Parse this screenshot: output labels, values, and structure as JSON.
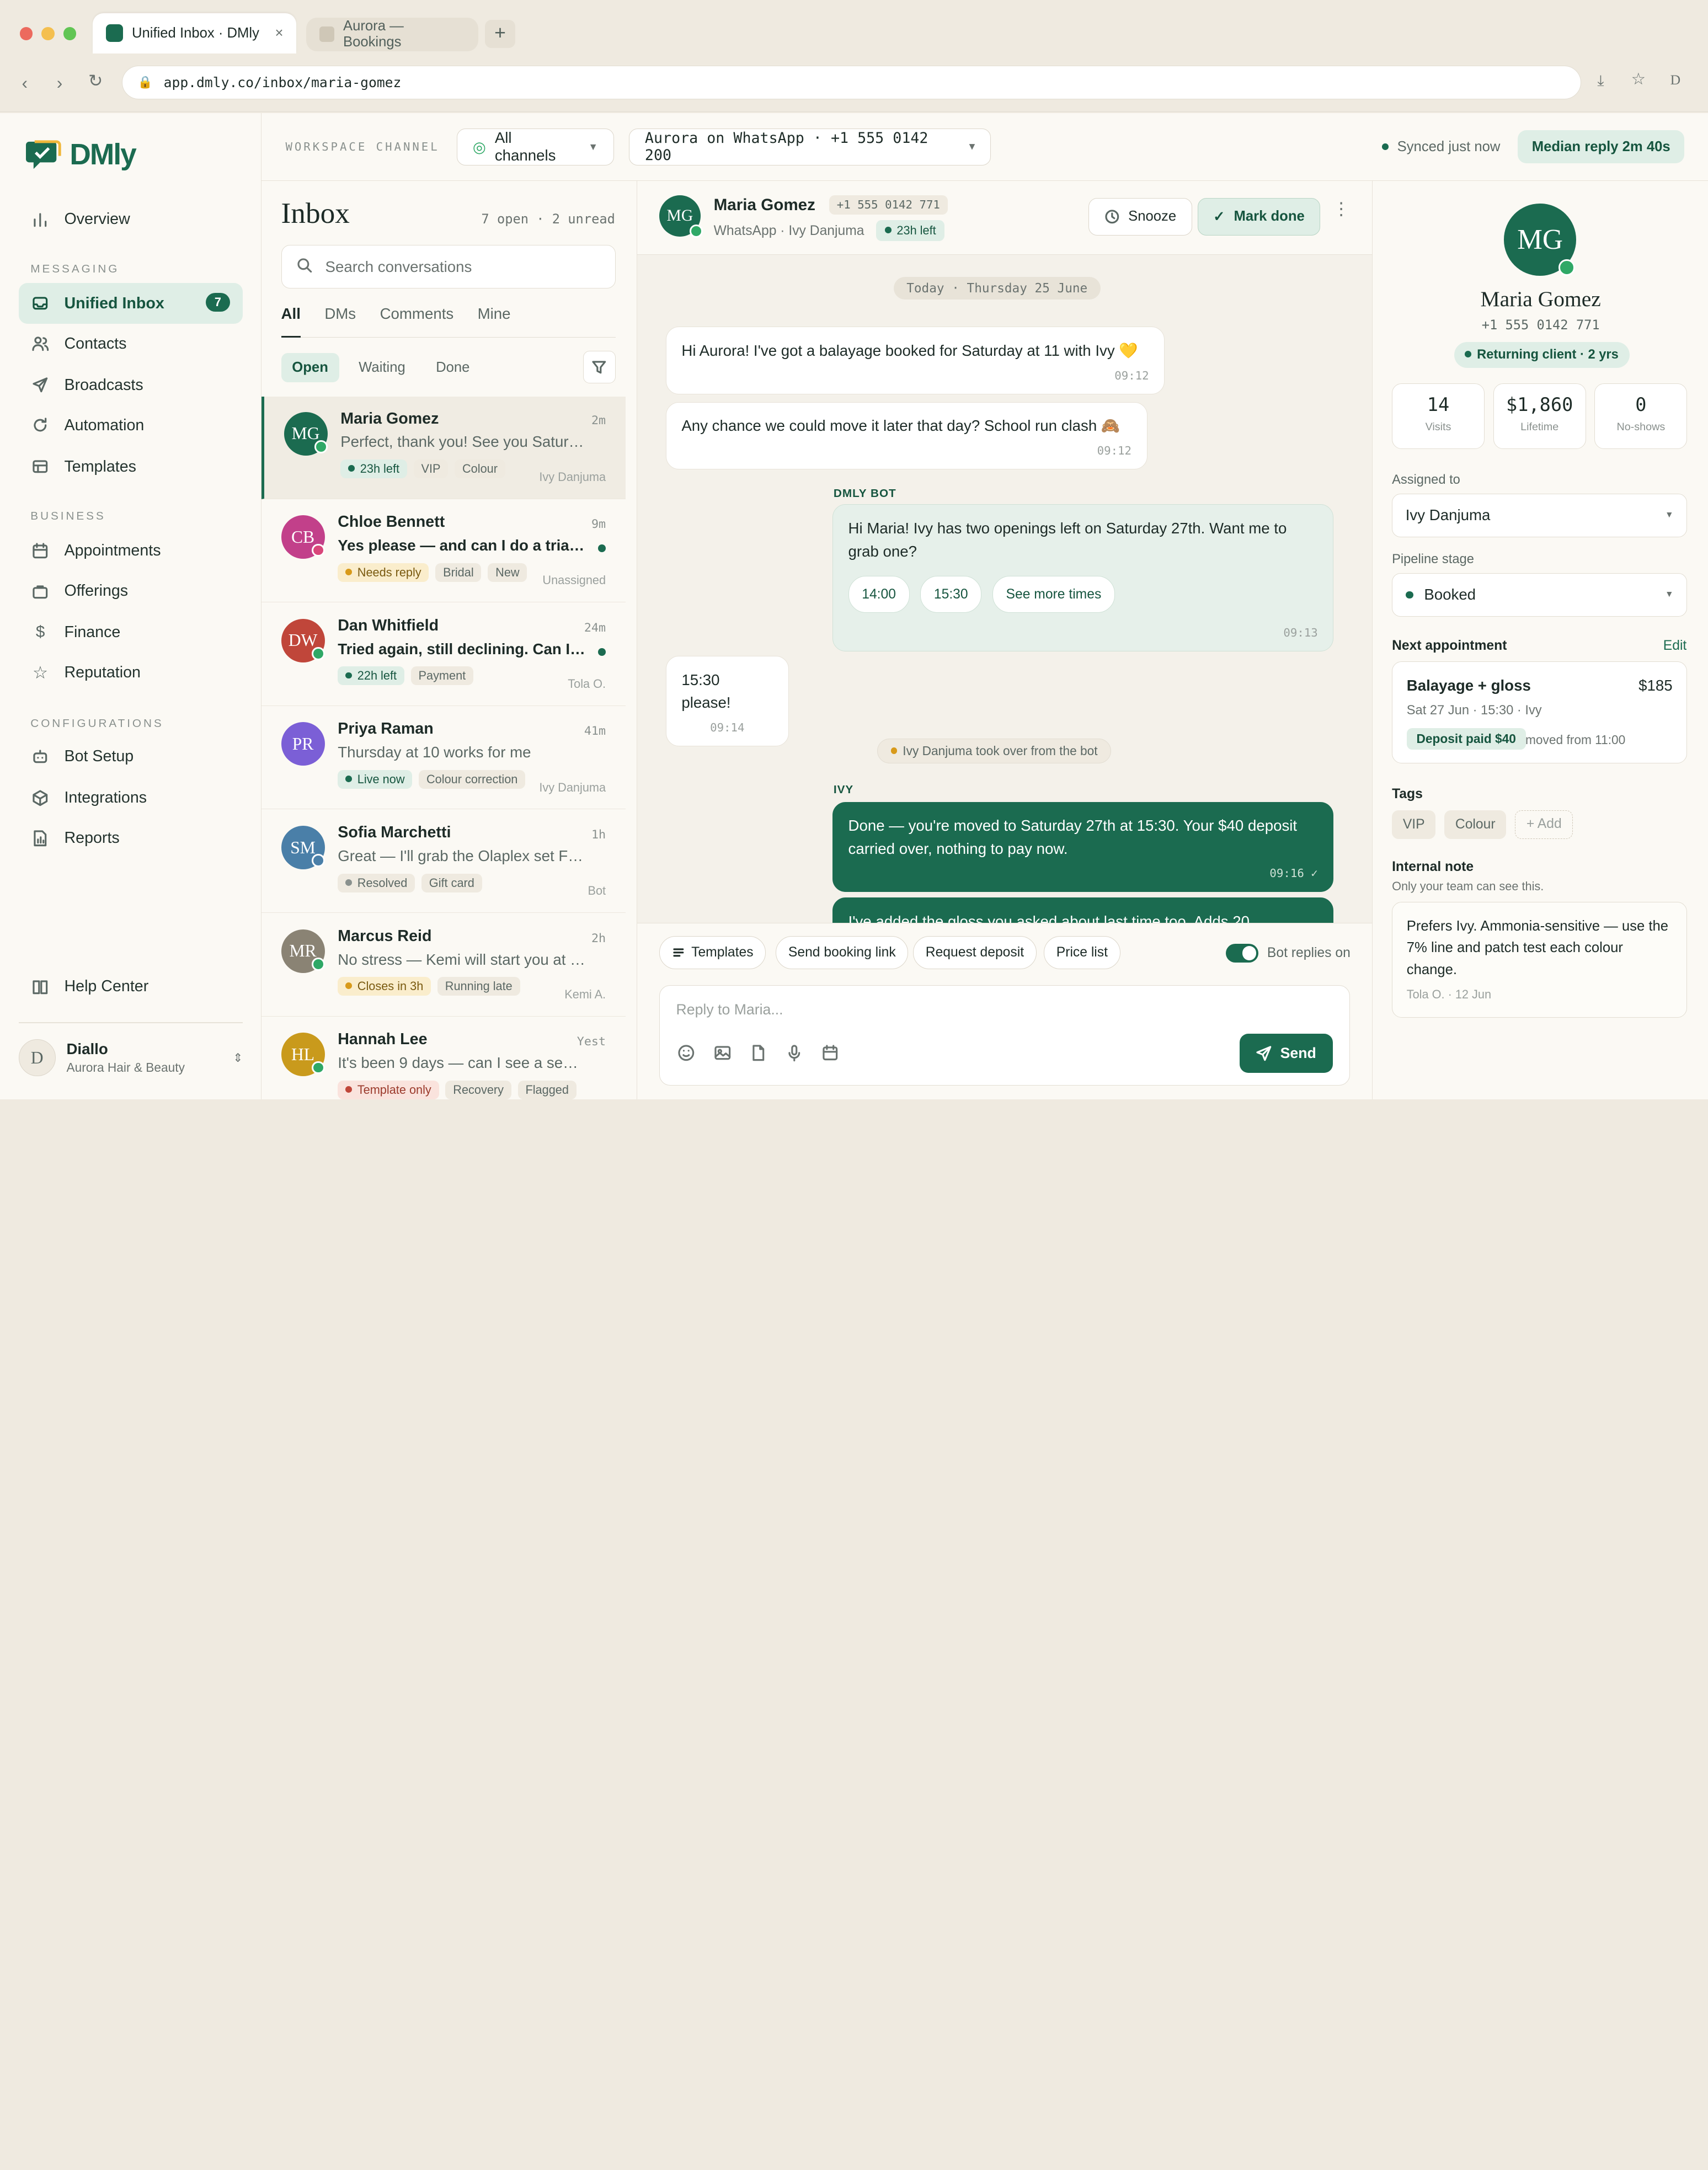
{
  "browser": {
    "tab_active": "Unified Inbox · DMly",
    "tab_inactive": "Aurora — Bookings",
    "url": "app.dmly.co/inbox/maria-gomez",
    "profile": "D"
  },
  "brand": {
    "name": "DMly",
    "color": "#1b6b50"
  },
  "sidebar": {
    "overview": "Overview",
    "sec_messaging": "MESSAGING",
    "messaging": [
      {
        "label": "Unified Inbox",
        "badge": "7",
        "icon": "inbox-icon"
      },
      {
        "label": "Contacts",
        "icon": "contacts-icon"
      },
      {
        "label": "Broadcasts",
        "icon": "send-icon"
      },
      {
        "label": "Automation",
        "icon": "refresh-icon"
      },
      {
        "label": "Templates",
        "icon": "template-icon"
      }
    ],
    "sec_business": "BUSINESS",
    "business": [
      {
        "label": "Appointments",
        "icon": "calendar-icon"
      },
      {
        "label": "Offerings",
        "icon": "bag-icon"
      },
      {
        "label": "Finance",
        "icon": "dollar-icon"
      },
      {
        "label": "Reputation",
        "icon": "star-icon"
      }
    ],
    "sec_config": "CONFIGURATIONS",
    "config": [
      {
        "label": "Bot Setup",
        "icon": "bot-icon"
      },
      {
        "label": "Integrations",
        "icon": "cube-icon"
      },
      {
        "label": "Reports",
        "icon": "report-icon"
      }
    ],
    "help": "Help Center",
    "user": {
      "initial": "D",
      "name": "Diallo",
      "org": "Aurora Hair & Beauty"
    }
  },
  "topbar": {
    "label": "WORKSPACE CHANNEL",
    "channels": "All channels",
    "account": "Aurora on WhatsApp · +1 555 0142 200",
    "synced": "Synced just now",
    "median": "Median reply 2m 40s"
  },
  "inbox": {
    "title": "Inbox",
    "counts": "7 open · 2 unread",
    "search_placeholder": "Search conversations",
    "tabs": [
      "All",
      "DMs",
      "Comments",
      "Mine"
    ],
    "filters": [
      "Open",
      "Waiting",
      "Done"
    ],
    "conversations": [
      {
        "initials": "MG",
        "color": "#1b6b50",
        "status": "#2fa866",
        "name": "Maria Gomez",
        "time": "2m",
        "preview": "Perfect, thank you! See you Saturda...",
        "unread": false,
        "tags": [
          {
            "t": "23h left",
            "c": "g",
            "dot": "#1b6b50"
          },
          {
            "t": "VIP",
            "c": ""
          },
          {
            "t": "Colour",
            "c": ""
          }
        ],
        "assignee": "Ivy Danjuma"
      },
      {
        "initials": "CB",
        "color": "#c2408a",
        "status": "#d9467a",
        "name": "Chloe Bennett",
        "time": "9m",
        "preview": "Yes please — and can I do a trial fir...",
        "unread": true,
        "tags": [
          {
            "t": "Needs reply",
            "c": "y",
            "dot": "#d89a1a"
          },
          {
            "t": "Bridal",
            "c": ""
          },
          {
            "t": "New",
            "c": ""
          }
        ],
        "assignee": "Unassigned"
      },
      {
        "initials": "DW",
        "color": "#c0463a",
        "status": "#2fa866",
        "name": "Dan Whitfield",
        "time": "24m",
        "preview": "Tried again, still declining. Can I pay...",
        "unread": true,
        "tags": [
          {
            "t": "22h left",
            "c": "g",
            "dot": "#1b6b50"
          },
          {
            "t": "Payment",
            "c": ""
          }
        ],
        "assignee": "Tola O."
      },
      {
        "initials": "PR",
        "color": "#7b5fd6",
        "status": "",
        "name": "Priya Raman",
        "time": "41m",
        "preview": "Thursday at 10 works for me",
        "unread": false,
        "tags": [
          {
            "t": "Live now",
            "c": "g",
            "dot": "#1b6b50"
          },
          {
            "t": "Colour correction",
            "c": ""
          }
        ],
        "assignee": "Ivy Danjuma"
      },
      {
        "initials": "SM",
        "color": "#4a7fa8",
        "status": "#4a7fa8",
        "name": "Sofia Marchetti",
        "time": "1h",
        "preview": "Great — I'll grab the Olaplex set Fri...",
        "unread": false,
        "tags": [
          {
            "t": "Resolved",
            "c": "",
            "dot": "#8a918e"
          },
          {
            "t": "Gift card",
            "c": ""
          }
        ],
        "assignee": "Bot"
      },
      {
        "initials": "MR",
        "color": "#8a8374",
        "status": "#2fa866",
        "name": "Marcus Reid",
        "time": "2h",
        "preview": "No stress — Kemi will start you at 1...",
        "unread": false,
        "tags": [
          {
            "t": "Closes in 3h",
            "c": "y",
            "dot": "#d89a1a"
          },
          {
            "t": "Running late",
            "c": ""
          }
        ],
        "assignee": "Kemi A."
      },
      {
        "initials": "HL",
        "color": "#c99a1c",
        "status": "#2fa866",
        "name": "Hannah Lee",
        "time": "Yest",
        "preview": "It's been 9 days — can I see a senio...",
        "unread": false,
        "tags": [
          {
            "t": "Template only",
            "c": "r",
            "dot": "#c0463a"
          },
          {
            "t": "Recovery",
            "c": ""
          },
          {
            "t": "Flagged",
            "c": ""
          }
        ],
        "assignee": ""
      }
    ]
  },
  "chat": {
    "initials": "MG",
    "name": "Maria Gomez",
    "phone": "+1 555 0142 771",
    "sub": "WhatsApp · Ivy Danjuma",
    "window": "23h left",
    "snooze": "Snooze",
    "mark_done": "Mark done",
    "date": "Today · Thursday 25 June",
    "msg1": "Hi Aurora! I've got a balayage booked for Saturday at 11 with Ivy 💛",
    "msg1_time": "09:12",
    "msg2": "Any chance we could move it later that day? School run clash 🙈",
    "msg2_time": "09:12",
    "bot_label": "DMLY BOT",
    "bot_msg": "Hi Maria! Ivy has two openings left on Saturday 27th. Want me to grab one?",
    "bot_chips": [
      "14:00",
      "15:30",
      "See more times"
    ],
    "bot_time": "09:13",
    "msg3": "15:30 please!",
    "msg3_time": "09:14",
    "takeover": "Ivy Danjuma took over from the bot",
    "ivy_label": "IVY",
    "ivy_msg": "Done — you're moved to Saturday 27th at 15:30. Your $40 deposit carried over, nothing to pay now.",
    "ivy_time": "09:16 ✓",
    "ivy_msg2": "I've added the gloss you asked about last time too. Adds 20",
    "quick": [
      "Templates",
      "Send booking link",
      "Request deposit",
      "Price list"
    ],
    "bot_toggle": "Bot replies on",
    "reply_placeholder": "Reply to Maria...",
    "send": "Send"
  },
  "profile": {
    "initials": "MG",
    "name": "Maria Gomez",
    "phone": "+1 555 0142 771",
    "status": "Returning client · 2 yrs",
    "stats": [
      {
        "v": "14",
        "l": "Visits"
      },
      {
        "v": "$1,860",
        "l": "Lifetime"
      },
      {
        "v": "0",
        "l": "No-shows"
      }
    ],
    "assigned_label": "Assigned to",
    "assigned": "Ivy Danjuma",
    "stage_label": "Pipeline stage",
    "stage": "Booked",
    "appt_label": "Next appointment",
    "edit": "Edit",
    "appt_title": "Balayage + gloss",
    "appt_price": "$185",
    "appt_time": "Sat 27 Jun · 15:30 · Ivy",
    "appt_deposit": "Deposit paid $40",
    "appt_moved": "moved from 11:00",
    "tags_label": "Tags",
    "tags": [
      "VIP",
      "Colour"
    ],
    "add_tag": "+ Add",
    "note_label": "Internal note",
    "note_sub": "Only your team can see this.",
    "note": "Prefers Ivy. Ammonia-sensitive — use the 7% line and patch test each colour change.",
    "note_meta": "Tola O. · 12 Jun"
  }
}
